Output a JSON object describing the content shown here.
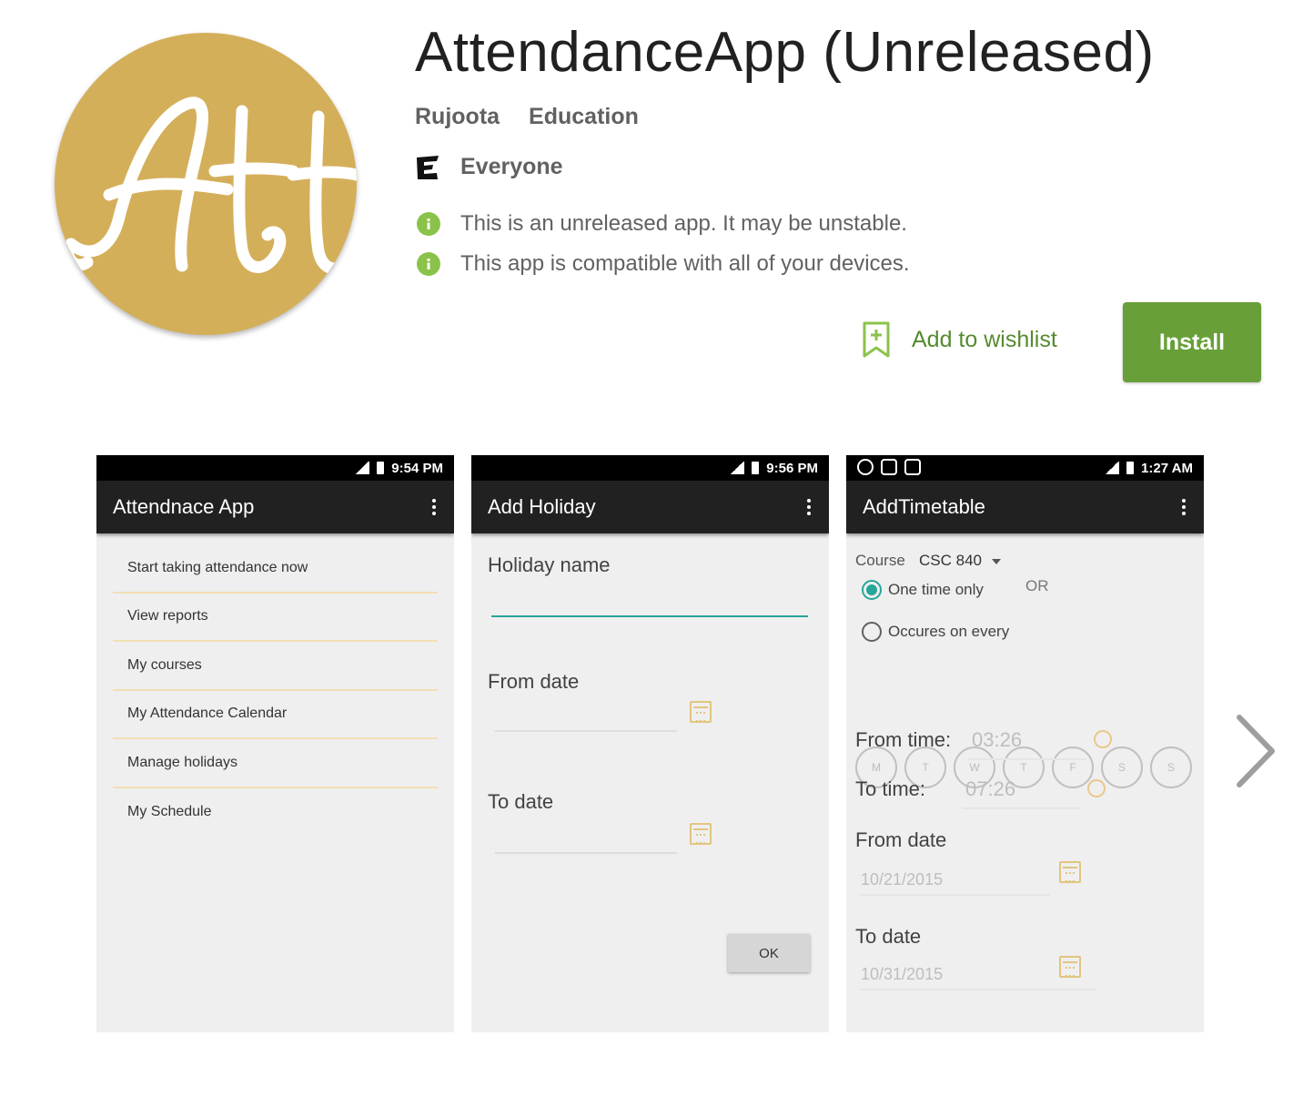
{
  "app": {
    "title": "AttendanceApp (Unreleased)",
    "developer": "Rujoota",
    "category": "Education",
    "content_rating": "Everyone",
    "icon_text": "Att",
    "notices": [
      "This is an unreleased app. It may be unstable.",
      "This app is compatible with all of your devices."
    ],
    "wishlist_label": "Add to wishlist",
    "install_label": "Install"
  },
  "colors": {
    "icon_bg": "#d4af5a",
    "install_green": "#689f38",
    "wishlist_green": "#558b2f",
    "info_green": "#8bc34a",
    "accent_teal": "#26a69a"
  },
  "screenshots": [
    {
      "time": "9:54 PM",
      "appbar_title": "Attendnace App",
      "menu": [
        "Start taking attendance now",
        "View reports",
        "My courses",
        "My Attendance Calendar",
        "Manage holidays",
        "My Schedule"
      ]
    },
    {
      "time": "9:56 PM",
      "appbar_title": "Add Holiday",
      "holiday_name_label": "Holiday name",
      "from_date_label": "From date",
      "to_date_label": "To date",
      "ok_label": "OK"
    },
    {
      "time": "1:27 AM",
      "appbar_title": "AddTimetable",
      "course_label": "Course",
      "course_value": "CSC 840",
      "one_time_label": "One time only",
      "or_label": "OR",
      "recurring_label": "Occures on every",
      "days": [
        "M",
        "T",
        "W",
        "T",
        "F",
        "S",
        "S"
      ],
      "from_time_label": "From time:",
      "from_time_value": "03:26",
      "to_time_label": "To time:",
      "to_time_value": "07:26",
      "from_date_label": "From date",
      "from_date_value": "10/21/2015",
      "to_date_label": "To date",
      "to_date_value": "10/31/2015"
    }
  ]
}
